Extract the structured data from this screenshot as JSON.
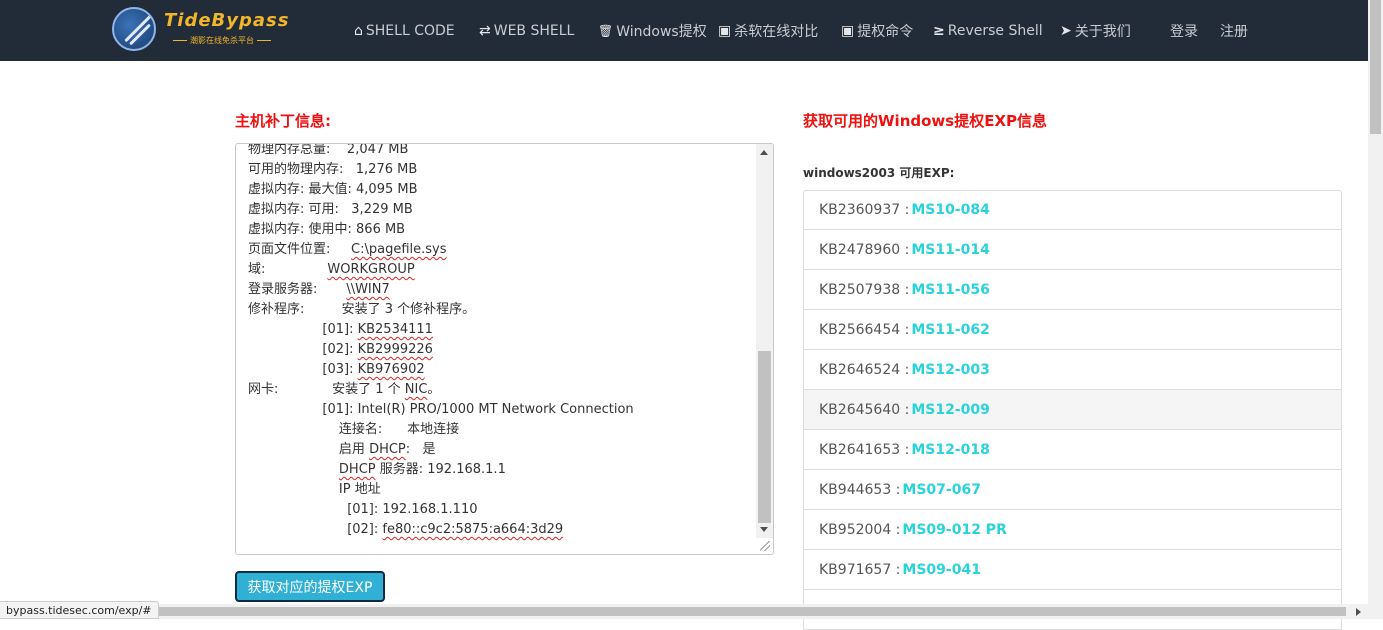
{
  "brand": {
    "name": "TideBypass",
    "subtitle": "潮影在线免杀平台"
  },
  "nav": {
    "items": [
      {
        "icon": "home-icon",
        "glyph": "⌂",
        "label": "SHELL CODE"
      },
      {
        "icon": "exchange-icon",
        "glyph": "⇄",
        "label": "WEB SHELL"
      },
      {
        "icon": "trash-icon",
        "glyph": "🗑",
        "label": "Windows提权"
      },
      {
        "icon": "console-icon",
        "glyph": "▣",
        "label": "杀软在线对比"
      },
      {
        "icon": "console-icon",
        "glyph": "▣",
        "label": "提权命令"
      },
      {
        "icon": "terminal-icon",
        "glyph": "≥",
        "label": "Reverse Shell"
      },
      {
        "icon": "send-icon",
        "glyph": "➤",
        "label": "关于我们"
      }
    ],
    "login": "登录",
    "register": "注册"
  },
  "left": {
    "title": "主机补丁信息:",
    "lines": [
      {
        "indent": "",
        "pre": "物理内存总量:    ",
        "sq": "",
        "post": "2,047 MB"
      },
      {
        "indent": "",
        "pre": "可用的物理内存:   1,276 MB",
        "sq": "",
        "post": ""
      },
      {
        "indent": "",
        "pre": "虚拟内存: 最大值: 4,095 MB",
        "sq": "",
        "post": ""
      },
      {
        "indent": "",
        "pre": "虚拟内存: 可用:   3,229 MB",
        "sq": "",
        "post": ""
      },
      {
        "indent": "",
        "pre": "虚拟内存: 使用中: 866 MB",
        "sq": "",
        "post": ""
      },
      {
        "indent": "",
        "pre": "页面文件位置:     ",
        "sq": "C:\\pagefile.sys",
        "post": ""
      },
      {
        "indent": "",
        "pre": "域:               ",
        "sq": "WORKGROUP",
        "post": ""
      },
      {
        "indent": "",
        "pre": "登录服务器:       ",
        "sq": "\\\\WIN7",
        "post": ""
      },
      {
        "indent": "",
        "pre": "修补程序:         安装了 3 个修补程序。",
        "sq": "",
        "post": ""
      },
      {
        "indent": "                  ",
        "pre": "[01]: ",
        "sq": "KB2534111",
        "post": ""
      },
      {
        "indent": "                  ",
        "pre": "[02]: ",
        "sq": "KB2999226",
        "post": ""
      },
      {
        "indent": "                  ",
        "pre": "[03]: ",
        "sq": "KB976902",
        "post": ""
      },
      {
        "indent": "",
        "pre": "网卡:             安装了 1 个 ",
        "sq": "NIC",
        "post": "。"
      },
      {
        "indent": "                  ",
        "pre": "[01]: Intel(R) PRO/1000 MT Network Connection",
        "sq": "",
        "post": ""
      },
      {
        "indent": "                      ",
        "pre": "连接名:      本地连接",
        "sq": "",
        "post": ""
      },
      {
        "indent": "                      ",
        "pre": "启用 ",
        "sq": "DHCP",
        "post": ":   是"
      },
      {
        "indent": "                      ",
        "pre": "",
        "sq": "DHCP",
        "post": " 服务器: 192.168.1.1"
      },
      {
        "indent": "                      ",
        "pre": "IP 地址",
        "sq": "",
        "post": ""
      },
      {
        "indent": "                        ",
        "pre": "[01]: 192.168.1.110",
        "sq": "",
        "post": ""
      },
      {
        "indent": "                        ",
        "pre": "[02]: ",
        "sq": "fe80::c9c2:5875:a664:3d29",
        "post": ""
      }
    ],
    "button": "获取对应的提权EXP"
  },
  "right": {
    "title": "获取可用的Windows提权EXP信息",
    "subtitle": "windows2003 可用EXP:",
    "items": [
      {
        "kb": "KB2360937 : ",
        "ms": "MS10-084",
        "hover": false
      },
      {
        "kb": "KB2478960 : ",
        "ms": "MS11-014",
        "hover": false
      },
      {
        "kb": "KB2507938 : ",
        "ms": "MS11-056",
        "hover": false
      },
      {
        "kb": "KB2566454 : ",
        "ms": "MS11-062",
        "hover": false
      },
      {
        "kb": "KB2646524 : ",
        "ms": "MS12-003",
        "hover": false
      },
      {
        "kb": "KB2645640 : ",
        "ms": "MS12-009",
        "hover": true
      },
      {
        "kb": "KB2641653 : ",
        "ms": "MS12-018",
        "hover": false
      },
      {
        "kb": "KB944653 : ",
        "ms": "MS07-067",
        "hover": false
      },
      {
        "kb": "KB952004 : ",
        "ms": "MS09-012 PR",
        "hover": false
      },
      {
        "kb": "KB971657 : ",
        "ms": "MS09-041",
        "hover": false
      },
      {
        "kb": "",
        "ms": "",
        "hover": false
      }
    ]
  },
  "status_url": "bypass.tidesec.com/exp/#"
}
